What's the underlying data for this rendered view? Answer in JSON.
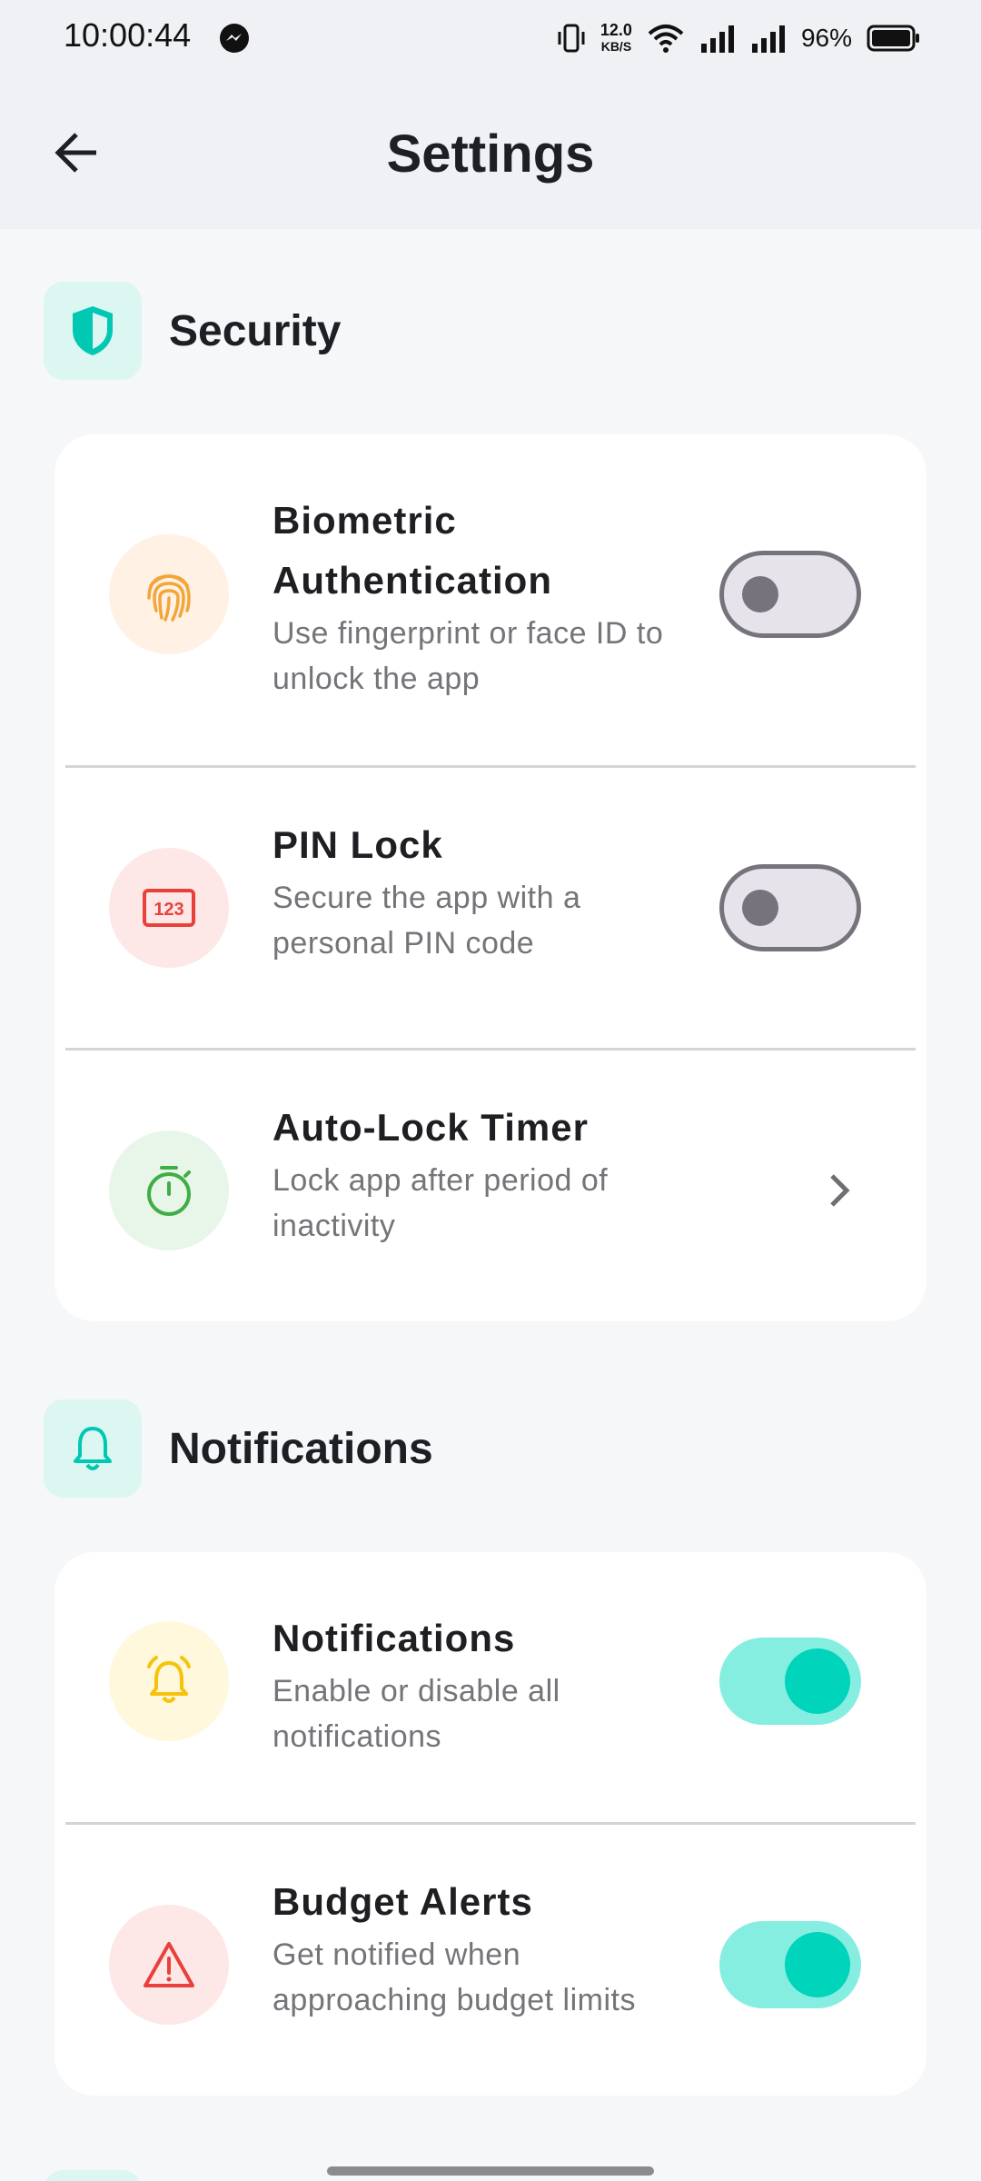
{
  "status_bar": {
    "time": "10:00:44",
    "net_speed_value": "12.0",
    "net_speed_unit": "KB/S",
    "battery": "96%"
  },
  "app_bar": {
    "title": "Settings",
    "back_icon": "arrow-left-icon"
  },
  "colors": {
    "accent": "#00d4bb",
    "toggle_on_track": "#86ede1",
    "toggle_off_track": "#e7e3ea",
    "toggle_off_knob": "#77737c"
  },
  "sections": [
    {
      "title": "Security",
      "icon": "shield-icon",
      "items": [
        {
          "title": "Biometric Authentication",
          "subtitle": "Use fingerprint or face ID to unlock the app",
          "icon": "fingerprint-icon",
          "control": "toggle",
          "enabled": false
        },
        {
          "title": "PIN Lock",
          "subtitle": "Secure the app with a personal PIN code",
          "icon": "pin-icon",
          "icon_text": "123",
          "control": "toggle",
          "enabled": false
        },
        {
          "title": "Auto-Lock Timer",
          "subtitle": "Lock app after period of inactivity",
          "icon": "timer-icon",
          "control": "chevron"
        }
      ]
    },
    {
      "title": "Notifications",
      "icon": "bell-icon",
      "items": [
        {
          "title": "Notifications",
          "subtitle": "Enable or disable all notifications",
          "icon": "bell-ring-icon",
          "control": "toggle",
          "enabled": true
        },
        {
          "title": "Budget Alerts",
          "subtitle": "Get notified when approaching budget limits",
          "icon": "warning-icon",
          "control": "toggle",
          "enabled": true
        }
      ]
    }
  ]
}
